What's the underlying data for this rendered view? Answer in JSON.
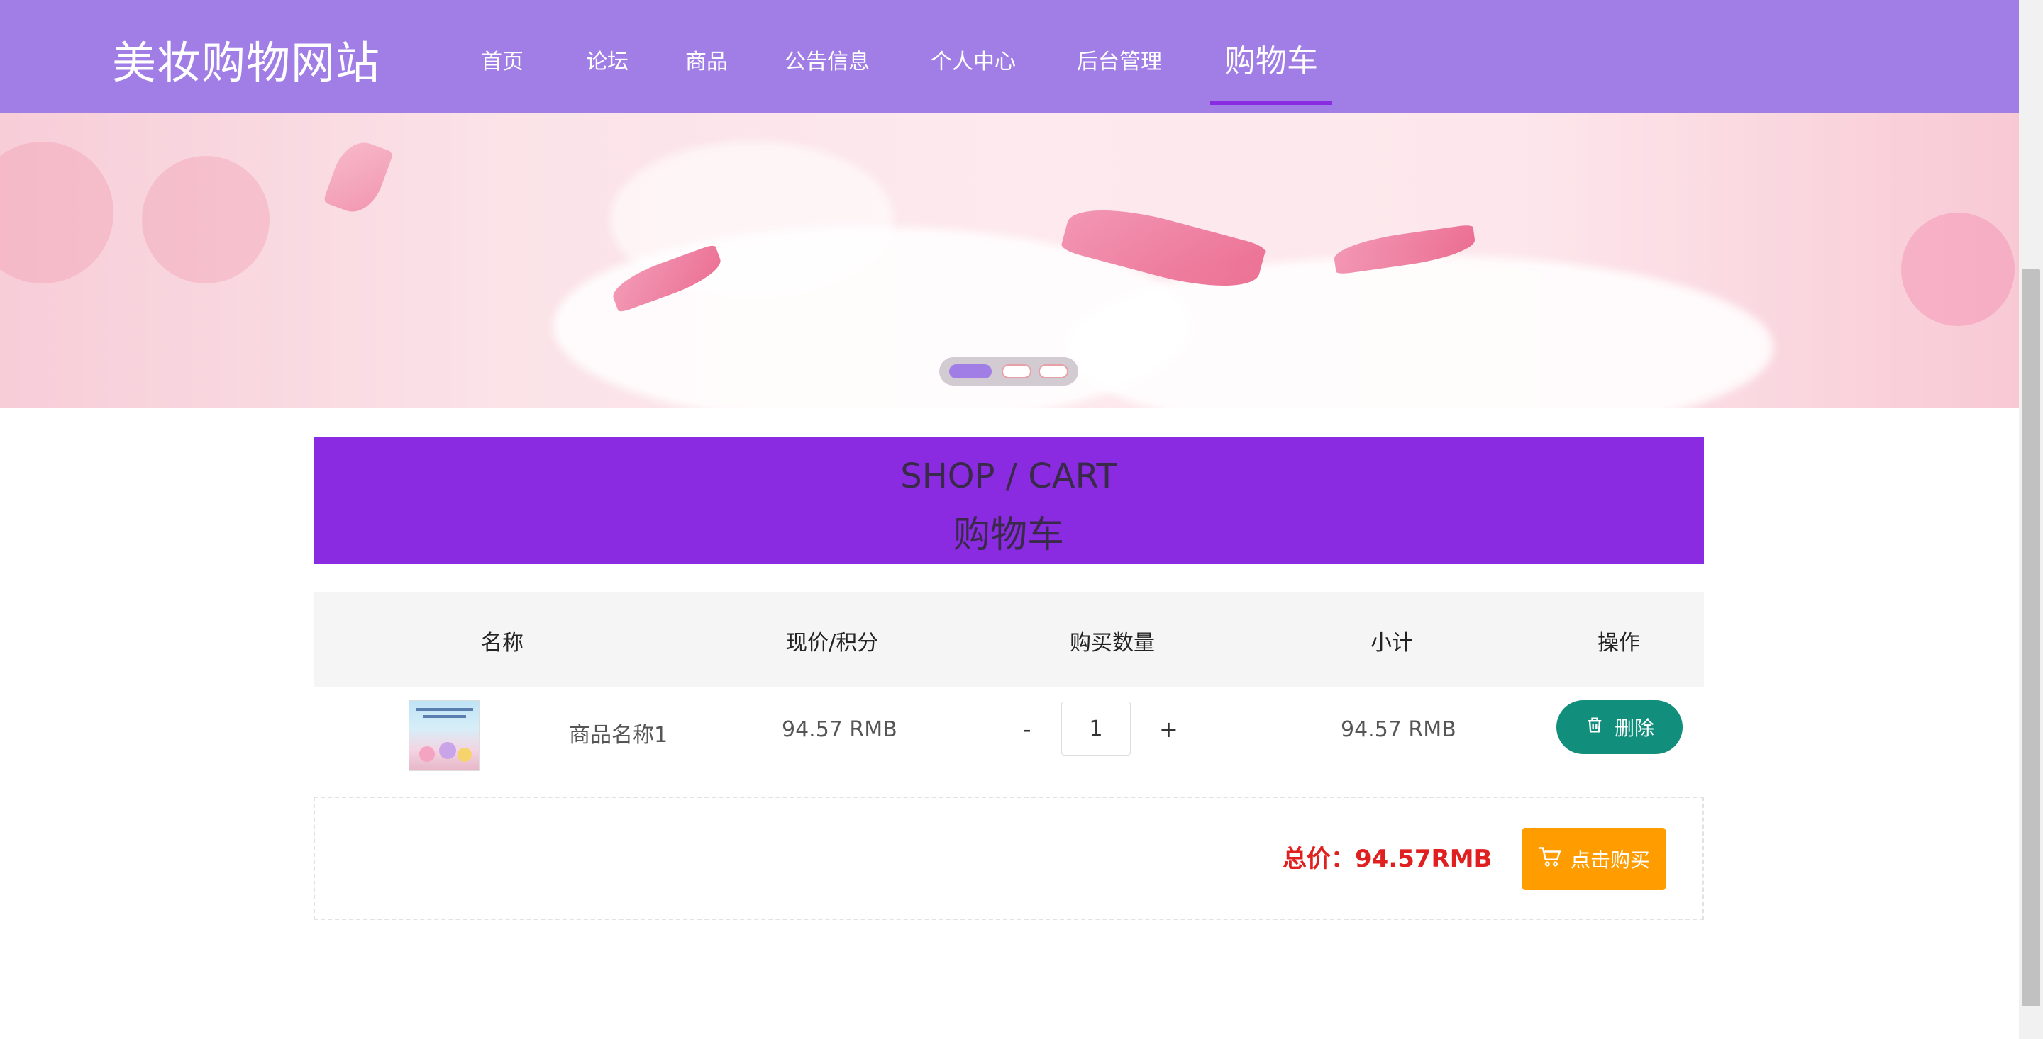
{
  "site": {
    "logo": "美妆购物网站",
    "nav": {
      "home": "首页",
      "forum": "论坛",
      "products": "商品",
      "notice": "公告信息",
      "profile": "个人中心",
      "admin": "后台管理",
      "cart": "购物车"
    },
    "active_nav": "cart"
  },
  "banner": {
    "slides_count": 3,
    "active_slide": 1
  },
  "cart_panel": {
    "title_en": "SHOP / CART",
    "title_cn": "购物车"
  },
  "table": {
    "headers": {
      "name": "名称",
      "price": "现价/积分",
      "quantity": "购买数量",
      "subtotal": "小计",
      "action": "操作"
    },
    "rows": [
      {
        "name": "商品名称1",
        "price": "94.57 RMB",
        "minus": "-",
        "quantity": "1",
        "plus": "+",
        "subtotal": "94.57 RMB",
        "delete_label": "删除"
      }
    ]
  },
  "summary": {
    "total": "总价：94.57RMB",
    "buy_label": "点击购买"
  },
  "colors": {
    "header": "#a07ee6",
    "panel": "#8a2be2",
    "delete": "#128f7c",
    "buy": "#ff9c00",
    "total": "#e02020"
  },
  "icons": {
    "delete": "trash-icon",
    "buy": "cart-icon"
  }
}
